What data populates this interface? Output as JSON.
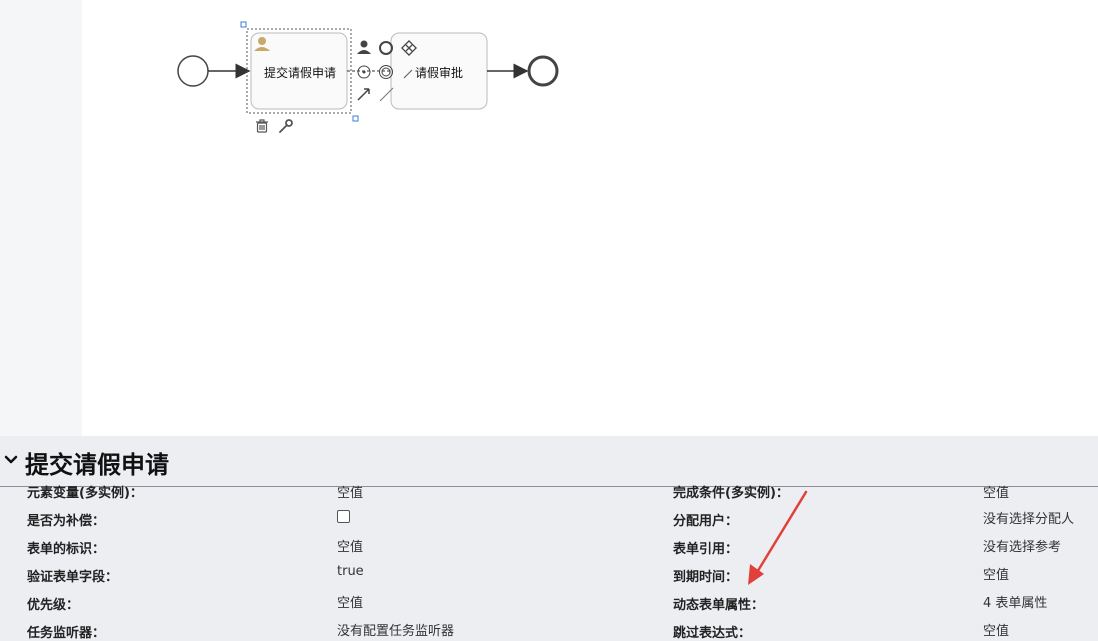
{
  "diagram": {
    "task1_label": "提交请假申请",
    "task2_label": "请假审批"
  },
  "panel": {
    "title": "提交请假申请",
    "left": [
      {
        "label": "元素变量(多实例)：",
        "value": "空值"
      },
      {
        "label": "是否为补偿：",
        "value": ""
      },
      {
        "label": "表单的标识：",
        "value": "空值"
      },
      {
        "label": "验证表单字段：",
        "value": "true"
      },
      {
        "label": "优先级：",
        "value": "空值"
      },
      {
        "label": "任务监听器：",
        "value": "没有配置任务监听器"
      }
    ],
    "right": [
      {
        "label": "完成条件(多实例)：",
        "value": "空值"
      },
      {
        "label": "分配用户：",
        "value": "没有选择分配人"
      },
      {
        "label": "表单引用：",
        "value": "没有选择参考"
      },
      {
        "label": "到期时间：",
        "value": "空值"
      },
      {
        "label": "动态表单属性：",
        "value": "4 表单属性"
      },
      {
        "label": "跳过表达式：",
        "value": "空值"
      }
    ]
  },
  "colors": {
    "panel_bg": "#eceef2",
    "annotation_arrow": "#e0413a",
    "user_icon": "#c9a86a"
  }
}
